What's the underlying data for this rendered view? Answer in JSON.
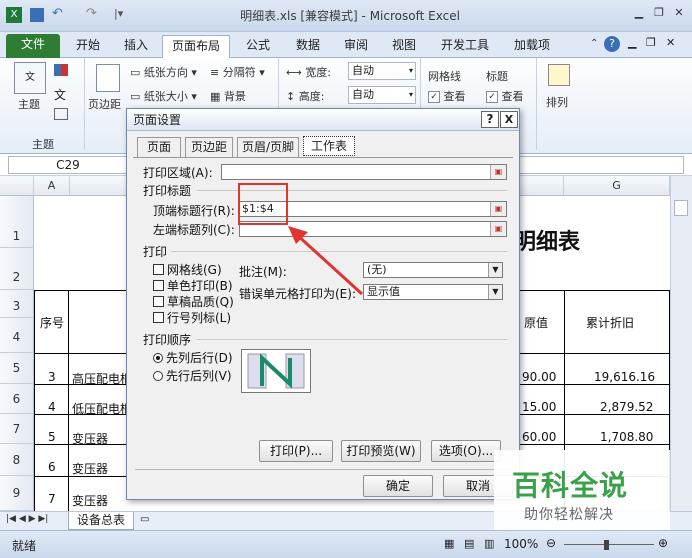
{
  "window": {
    "title": "明细表.xls [兼容模式] - Microsoft Excel"
  },
  "ribbon_tabs": [
    {
      "label": "文件"
    },
    {
      "label": "开始"
    },
    {
      "label": "插入"
    },
    {
      "label": "页面布局"
    },
    {
      "label": "公式"
    },
    {
      "label": "数据"
    },
    {
      "label": "审阅"
    },
    {
      "label": "视图"
    },
    {
      "label": "开发工具"
    },
    {
      "label": "加载项"
    }
  ],
  "ribbon": {
    "theme_label": "主题",
    "group_theme": "主题",
    "margins_label": "页边距",
    "orientation_label": "纸张方向",
    "size_label": "纸张大小",
    "breaks_label": "分隔符",
    "background_label": "背景",
    "width_label": "宽度:",
    "height_label": "高度:",
    "width_value": "自动",
    "height_value": "自动",
    "gridlines_label": "网格线",
    "headings_label": "标题",
    "view_label": "查看",
    "arrange_label": "排列"
  },
  "formula_bar": {
    "name_box": "C29"
  },
  "columns": [
    "A",
    "G"
  ],
  "rows": [
    "1",
    "2",
    "3",
    "4",
    "5",
    "6",
    "7",
    "8",
    "9"
  ],
  "sheet_cells": {
    "title": "明细表",
    "seq_header": "序号",
    "value_header": "原值",
    "cum_header": "累计折旧",
    "r5": {
      "seq": "3",
      "name": "高压配电柜",
      "val": "90.00",
      "cum": "19,616.16"
    },
    "r6": {
      "seq": "4",
      "name": "低压配电柜",
      "val": "15.00",
      "cum": "2,879.52"
    },
    "r7": {
      "seq": "5",
      "name": "变压器",
      "val": "60.00",
      "cum": "1,708.80"
    },
    "r8": {
      "seq": "6",
      "name": "变压器"
    },
    "r9": {
      "seq": "7",
      "name": "变压器"
    }
  },
  "sheet_tab": "设备总表",
  "status": {
    "ready": "就绪",
    "zoom": "100%"
  },
  "dialog": {
    "title": "页面设置",
    "help": "?",
    "close": "X",
    "tabs": [
      {
        "label": "页面"
      },
      {
        "label": "页边距"
      },
      {
        "label": "页眉/页脚"
      },
      {
        "label": "工作表"
      }
    ],
    "print_area_label": "打印区域(A):",
    "print_titles_label": "打印标题",
    "top_rows_label": "顶端标题行(R):",
    "top_rows_value": "$1:$4",
    "left_cols_label": "左端标题列(C):",
    "print_section_label": "打印",
    "gridlines_cb": "网格线(G)",
    "bw_cb": "单色打印(B)",
    "draft_cb": "草稿品质(Q)",
    "rowcol_cb": "行号列标(L)",
    "comments_label": "批注(M):",
    "comments_value": "(无)",
    "errors_label": "错误单元格打印为(E):",
    "errors_value": "显示值",
    "order_label": "打印顺序",
    "down_then_over": "先列后行(D)",
    "over_then_down": "先行后列(V)",
    "print_btn": "打印(P)...",
    "preview_btn": "打印预览(W)",
    "options_btn": "选项(O)...",
    "ok_btn": "确定",
    "cancel_btn": "取消"
  },
  "watermark": {
    "main": "百科全说",
    "sub": "助你轻松解决"
  },
  "colors": {
    "file_tab": "#2e7d32",
    "arrow": "#e0342e",
    "watermark_green": "#3aa14a"
  }
}
